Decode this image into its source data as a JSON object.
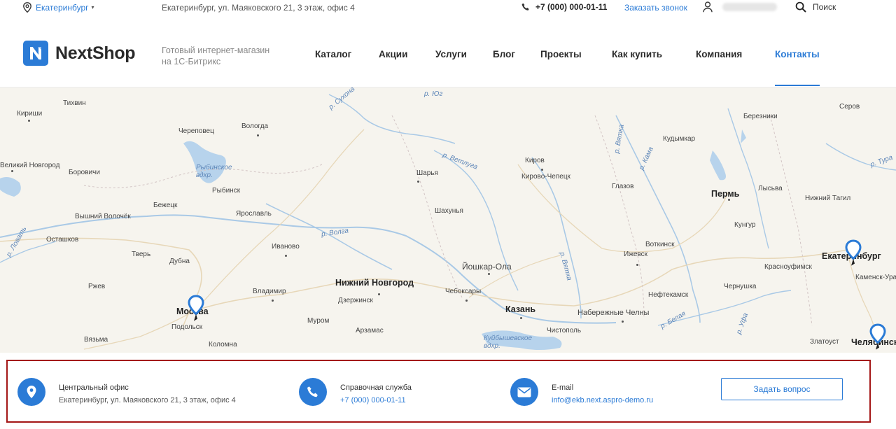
{
  "topbar": {
    "city": "Екатеринбург",
    "address": "Екатеринбург, ул. Маяковского 21, 3 этаж, офис 4",
    "phone": "+7 (000) 000-01-11",
    "callback": "Заказать звонок",
    "search": "Поиск"
  },
  "header": {
    "logo": "NextShop",
    "slogan_line1": "Готовый интернет-магазин",
    "slogan_line2": "на 1С-Битрикс"
  },
  "nav": {
    "items": [
      "Каталог",
      "Акции",
      "Услуги",
      "Блог",
      "Проекты",
      "Как купить",
      "Компания",
      "Контакты"
    ],
    "active": "Контакты"
  },
  "map": {
    "cities_major": [
      "Нижний Новгород",
      "Казань",
      "Пермь",
      "Екатеринбург",
      "Москва",
      "Челябинск"
    ],
    "cities": [
      "Кириши",
      "Тихвин",
      "Череповец",
      "Вологда",
      "Серов",
      "Березники",
      "Кудымкар",
      "Великий Новгород",
      "Боровичи",
      "Рыбинск",
      "Киров",
      "Кирово-Чепецк",
      "Шарья",
      "Глазов",
      "Лысьва",
      "Нижний Тагил",
      "Бежецк",
      "Ярославль",
      "Шахунья",
      "Вышний Волочёк",
      "Осташков",
      "Иваново",
      "Йошкар-Ола",
      "Кунгур",
      "Тверь",
      "Дубна",
      "Воткинск",
      "Ижевск",
      "Красноуфимск",
      "Ржев",
      "Владимир",
      "Чебоксары",
      "Каменск-Ура",
      "Нефтекамск",
      "Чернушка",
      "Дзержинск",
      "Набережные Челны",
      "Подольск",
      "Муром",
      "Арзамас",
      "Чистополь",
      "Златоуст",
      "Вязьма",
      "Коломна"
    ],
    "rivers": [
      "р. Юг",
      "р. Сухона",
      "р. Вятка",
      "р. Кама",
      "р. Тура",
      "Рыбинское вдхр.",
      "р. Ветлуга",
      "р. Волга",
      "р. Белая",
      "р. Уфа",
      "р. Ловать",
      "Куйбышевское вдхр.",
      "р. Вятка"
    ],
    "pins": [
      "Москва",
      "Екатеринбург",
      "Челябинск"
    ]
  },
  "contacts": {
    "office_title": "Центральный офис",
    "office_value": "Екатеринбург, ул. Маяковского 21, 3 этаж, офис 4",
    "help_title": "Справочная служба",
    "help_value": "+7 (000) 000-01-11",
    "email_title": "E-mail",
    "email_value": "info@ekb.next.aspro-demo.ru",
    "ask_button": "Задать вопрос"
  },
  "colors": {
    "accent": "#2b7bd6",
    "highlight_border": "#a41717",
    "map_bg": "#f6f4ee",
    "water": "#b7d3ec"
  }
}
